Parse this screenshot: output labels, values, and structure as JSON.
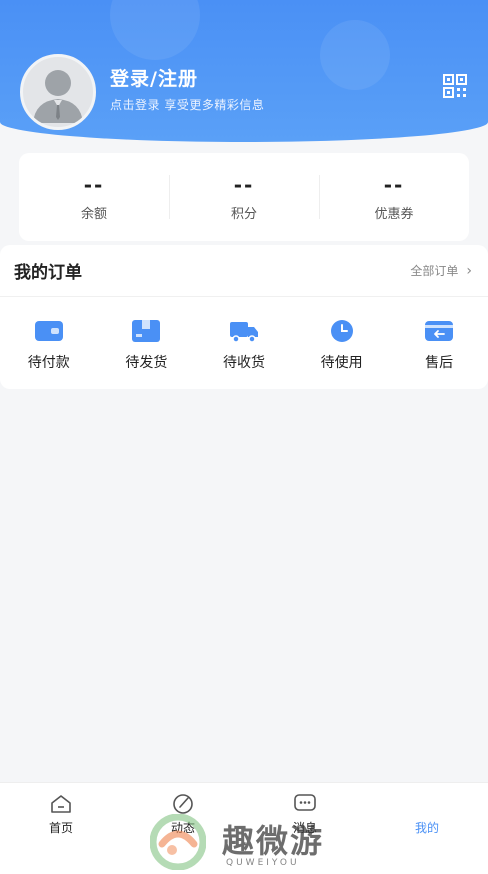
{
  "profile": {
    "title": "登录/注册",
    "subtitle": "点击登录 享受更多精彩信息"
  },
  "stats": [
    {
      "value": "--",
      "label": "余额"
    },
    {
      "value": "--",
      "label": "积分"
    },
    {
      "value": "--",
      "label": "优惠券"
    }
  ],
  "orders": {
    "title": "我的订单",
    "all_label": "全部订单",
    "items": [
      {
        "label": "待付款",
        "icon": "wallet-icon"
      },
      {
        "label": "待发货",
        "icon": "package-icon"
      },
      {
        "label": "待收货",
        "icon": "truck-icon"
      },
      {
        "label": "待使用",
        "icon": "clock-icon"
      },
      {
        "label": "售后",
        "icon": "return-icon"
      }
    ]
  },
  "tabbar": {
    "items": [
      {
        "label": "首页",
        "icon": "home-icon",
        "active": false
      },
      {
        "label": "动态",
        "icon": "compass-icon",
        "active": false
      },
      {
        "label": "消息",
        "icon": "chat-icon",
        "active": false
      },
      {
        "label": "我的",
        "icon": "",
        "active": true
      }
    ]
  },
  "watermark": {
    "text": "趣微游",
    "sub": "QUWEIYOU"
  },
  "colors": {
    "accent": "#4a90f5",
    "background": "#f5f6f8"
  }
}
